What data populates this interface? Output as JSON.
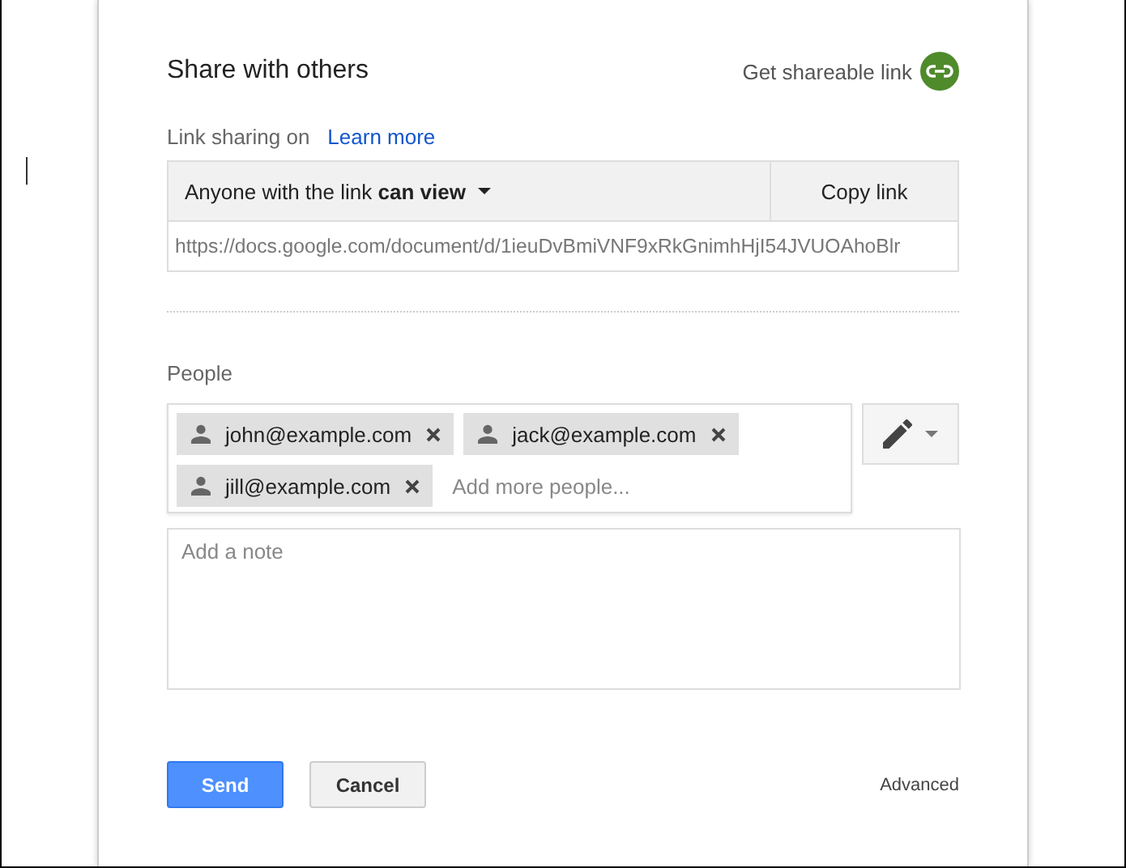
{
  "dialog": {
    "title": "Share with others",
    "shareable_link": {
      "label": "Get shareable link"
    },
    "link_sharing": {
      "label": "Link sharing on",
      "learn_more": "Learn more",
      "access_prefix": "Anyone with the link",
      "access_level": "can view",
      "copy_button": "Copy link",
      "url": "https://docs.google.com/document/d/1ieuDvBmiVNF9xRkGnimhHjI54JVUOAhoBlr"
    },
    "people": {
      "label": "People",
      "chips": [
        {
          "email": "john@example.com"
        },
        {
          "email": "jack@example.com"
        },
        {
          "email": "jill@example.com"
        }
      ],
      "placeholder": "Add more people..."
    },
    "note": {
      "placeholder": "Add a note"
    },
    "buttons": [
      {
        "label": "Send",
        "kind": "primary"
      },
      {
        "label": "Cancel",
        "kind": "secondary"
      }
    ],
    "advanced": "Advanced"
  }
}
